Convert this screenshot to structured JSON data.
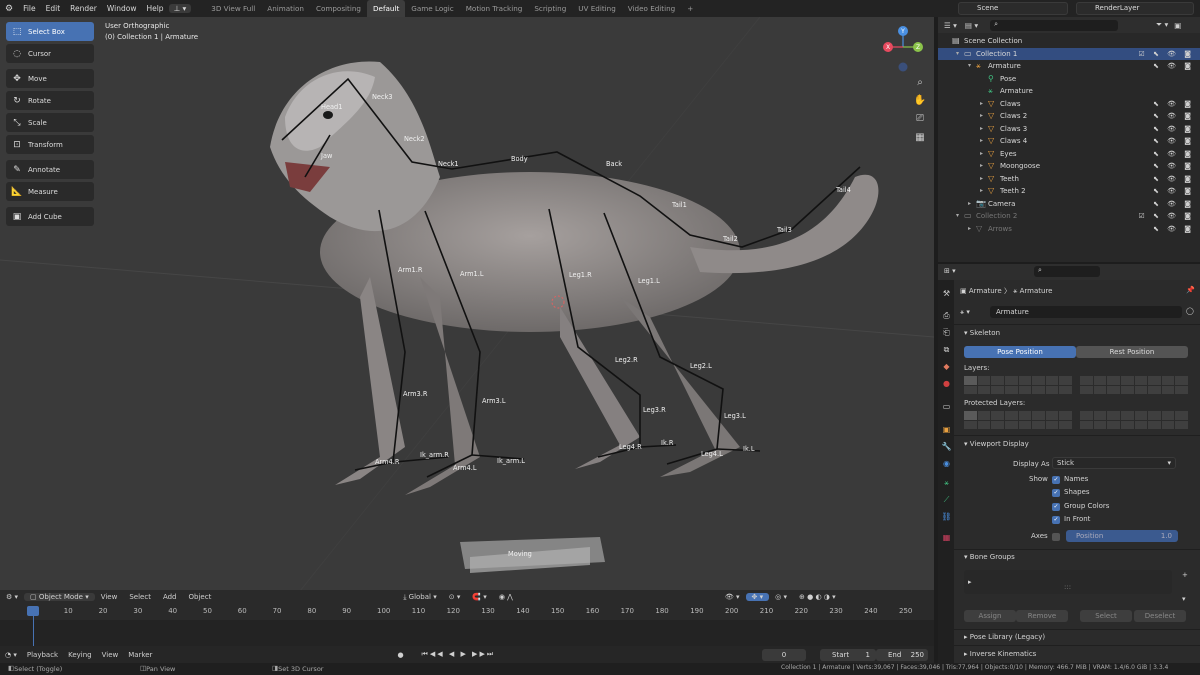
{
  "topbar": {
    "menus": [
      "File",
      "Edit",
      "Render",
      "Window",
      "Help"
    ],
    "workspaces": [
      "3D View Full",
      "Animation",
      "Compositing",
      "Default",
      "Game Logic",
      "Motion Tracking",
      "Scripting",
      "UV Editing",
      "Video Editing"
    ],
    "active_workspace": "Default",
    "add_tab": "+",
    "scene": "Scene",
    "view_layer": "RenderLayer"
  },
  "toolbar": [
    {
      "label": "Select Box",
      "icon": "select-box-icon",
      "active": true
    },
    {
      "label": "Cursor",
      "icon": "cursor-icon"
    },
    {
      "label": "Move",
      "icon": "move-icon"
    },
    {
      "label": "Rotate",
      "icon": "rotate-icon"
    },
    {
      "label": "Scale",
      "icon": "scale-icon"
    },
    {
      "label": "Transform",
      "icon": "transform-icon"
    },
    {
      "label": "Annotate",
      "icon": "annotate-icon"
    },
    {
      "label": "Measure",
      "icon": "measure-icon"
    },
    {
      "label": "Add Cube",
      "icon": "add-cube-icon"
    }
  ],
  "viewport": {
    "view_name": "User Orthographic",
    "collection_path": "(0) Collection 1 | Armature",
    "bones": [
      "Head1",
      "Neck3",
      "Jaw",
      "Neck2",
      "Neck1",
      "Body",
      "Back",
      "Tail1",
      "Tail2",
      "Tail3",
      "Tail4",
      "Arm1.R",
      "Arm1.L",
      "Leg1.R",
      "Leg1.L",
      "Leg2.R",
      "Leg2.L",
      "Arm3.R",
      "Arm3.L",
      "Leg3.R",
      "Leg3.L",
      "Ik_arm.R",
      "Ik_arm.L",
      "Arm4.R",
      "Arm4.L",
      "Leg4.R",
      "Leg4.L",
      "Ik.R",
      "Ik.L",
      "Moving"
    ],
    "gizmo_axes": [
      "Y",
      "X",
      "Z"
    ]
  },
  "viewport_header": {
    "mode": "Object Mode",
    "menus": [
      "View",
      "Select",
      "Add",
      "Object"
    ],
    "orientation": "Global"
  },
  "timeline": {
    "ticks": [
      "0",
      "10",
      "20",
      "30",
      "40",
      "50",
      "60",
      "70",
      "80",
      "90",
      "100",
      "110",
      "120",
      "130",
      "140",
      "150",
      "160",
      "170",
      "180",
      "190",
      "200",
      "210",
      "220",
      "230",
      "240",
      "250"
    ],
    "current_frame": "0",
    "menus": [
      "Playback",
      "Keying",
      "View",
      "Marker"
    ],
    "frame_field": "0",
    "start_label": "Start",
    "start_value": "1",
    "end_label": "End",
    "end_value": "250"
  },
  "statusbar": {
    "select": "Select (Toggle)",
    "pan": "Pan View",
    "cursor": "Set 3D Cursor",
    "stats": "Collection 1 | Armature | Verts:39,067 | Faces:39,046 | Tris:77,964 | Objects:0/10 | Memory: 466.7 MiB | VRAM: 1.4/6.0 GiB | 3.3.4"
  },
  "outliner": {
    "rows": [
      {
        "label": "Scene Collection",
        "indent": 0
      },
      {
        "label": "Collection 1",
        "indent": 1
      },
      {
        "label": "Armature",
        "indent": 2
      },
      {
        "label": "Pose",
        "indent": 3
      },
      {
        "label": "Armature",
        "indent": 3
      },
      {
        "label": "Claws",
        "indent": 3
      },
      {
        "label": "Claws 2",
        "indent": 3
      },
      {
        "label": "Claws 3",
        "indent": 3
      },
      {
        "label": "Claws 4",
        "indent": 3
      },
      {
        "label": "Eyes",
        "indent": 3
      },
      {
        "label": "Moongoose",
        "indent": 3
      },
      {
        "label": "Teeth",
        "indent": 3
      },
      {
        "label": "Teeth 2",
        "indent": 3
      },
      {
        "label": "Camera",
        "indent": 2
      },
      {
        "label": "Collection 2",
        "indent": 1
      },
      {
        "label": "Arrows",
        "indent": 2
      }
    ]
  },
  "properties": {
    "breadcrumb_object": "Armature",
    "breadcrumb_data": "Armature",
    "data_name": "Armature",
    "skeleton_label": "Skeleton",
    "pose_position": "Pose Position",
    "rest_position": "Rest Position",
    "layers_label": "Layers:",
    "protected_layers_label": "Protected Layers:",
    "viewport_display_label": "Viewport Display",
    "display_as_label": "Display As",
    "display_as_value": "Stick",
    "show_label": "Show",
    "show_names": "Names",
    "show_shapes": "Shapes",
    "show_group_colors": "Group Colors",
    "show_in_front": "In Front",
    "axes_label": "Axes",
    "axes_position": "Position",
    "axes_value": "1.0",
    "bone_groups_label": "Bone Groups",
    "bone_groups_list_hint": ":::",
    "assign": "Assign",
    "remove": "Remove",
    "select": "Select",
    "deselect": "Deselect",
    "pose_library_label": "Pose Library (Legacy)",
    "ik_label": "Inverse Kinematics"
  },
  "colors": {
    "accent": "#4772b3",
    "bone_line": "#111111",
    "x_axis": "#e84a5f",
    "y_axis": "#8bc34a",
    "z_axis": "#4a90e2"
  }
}
